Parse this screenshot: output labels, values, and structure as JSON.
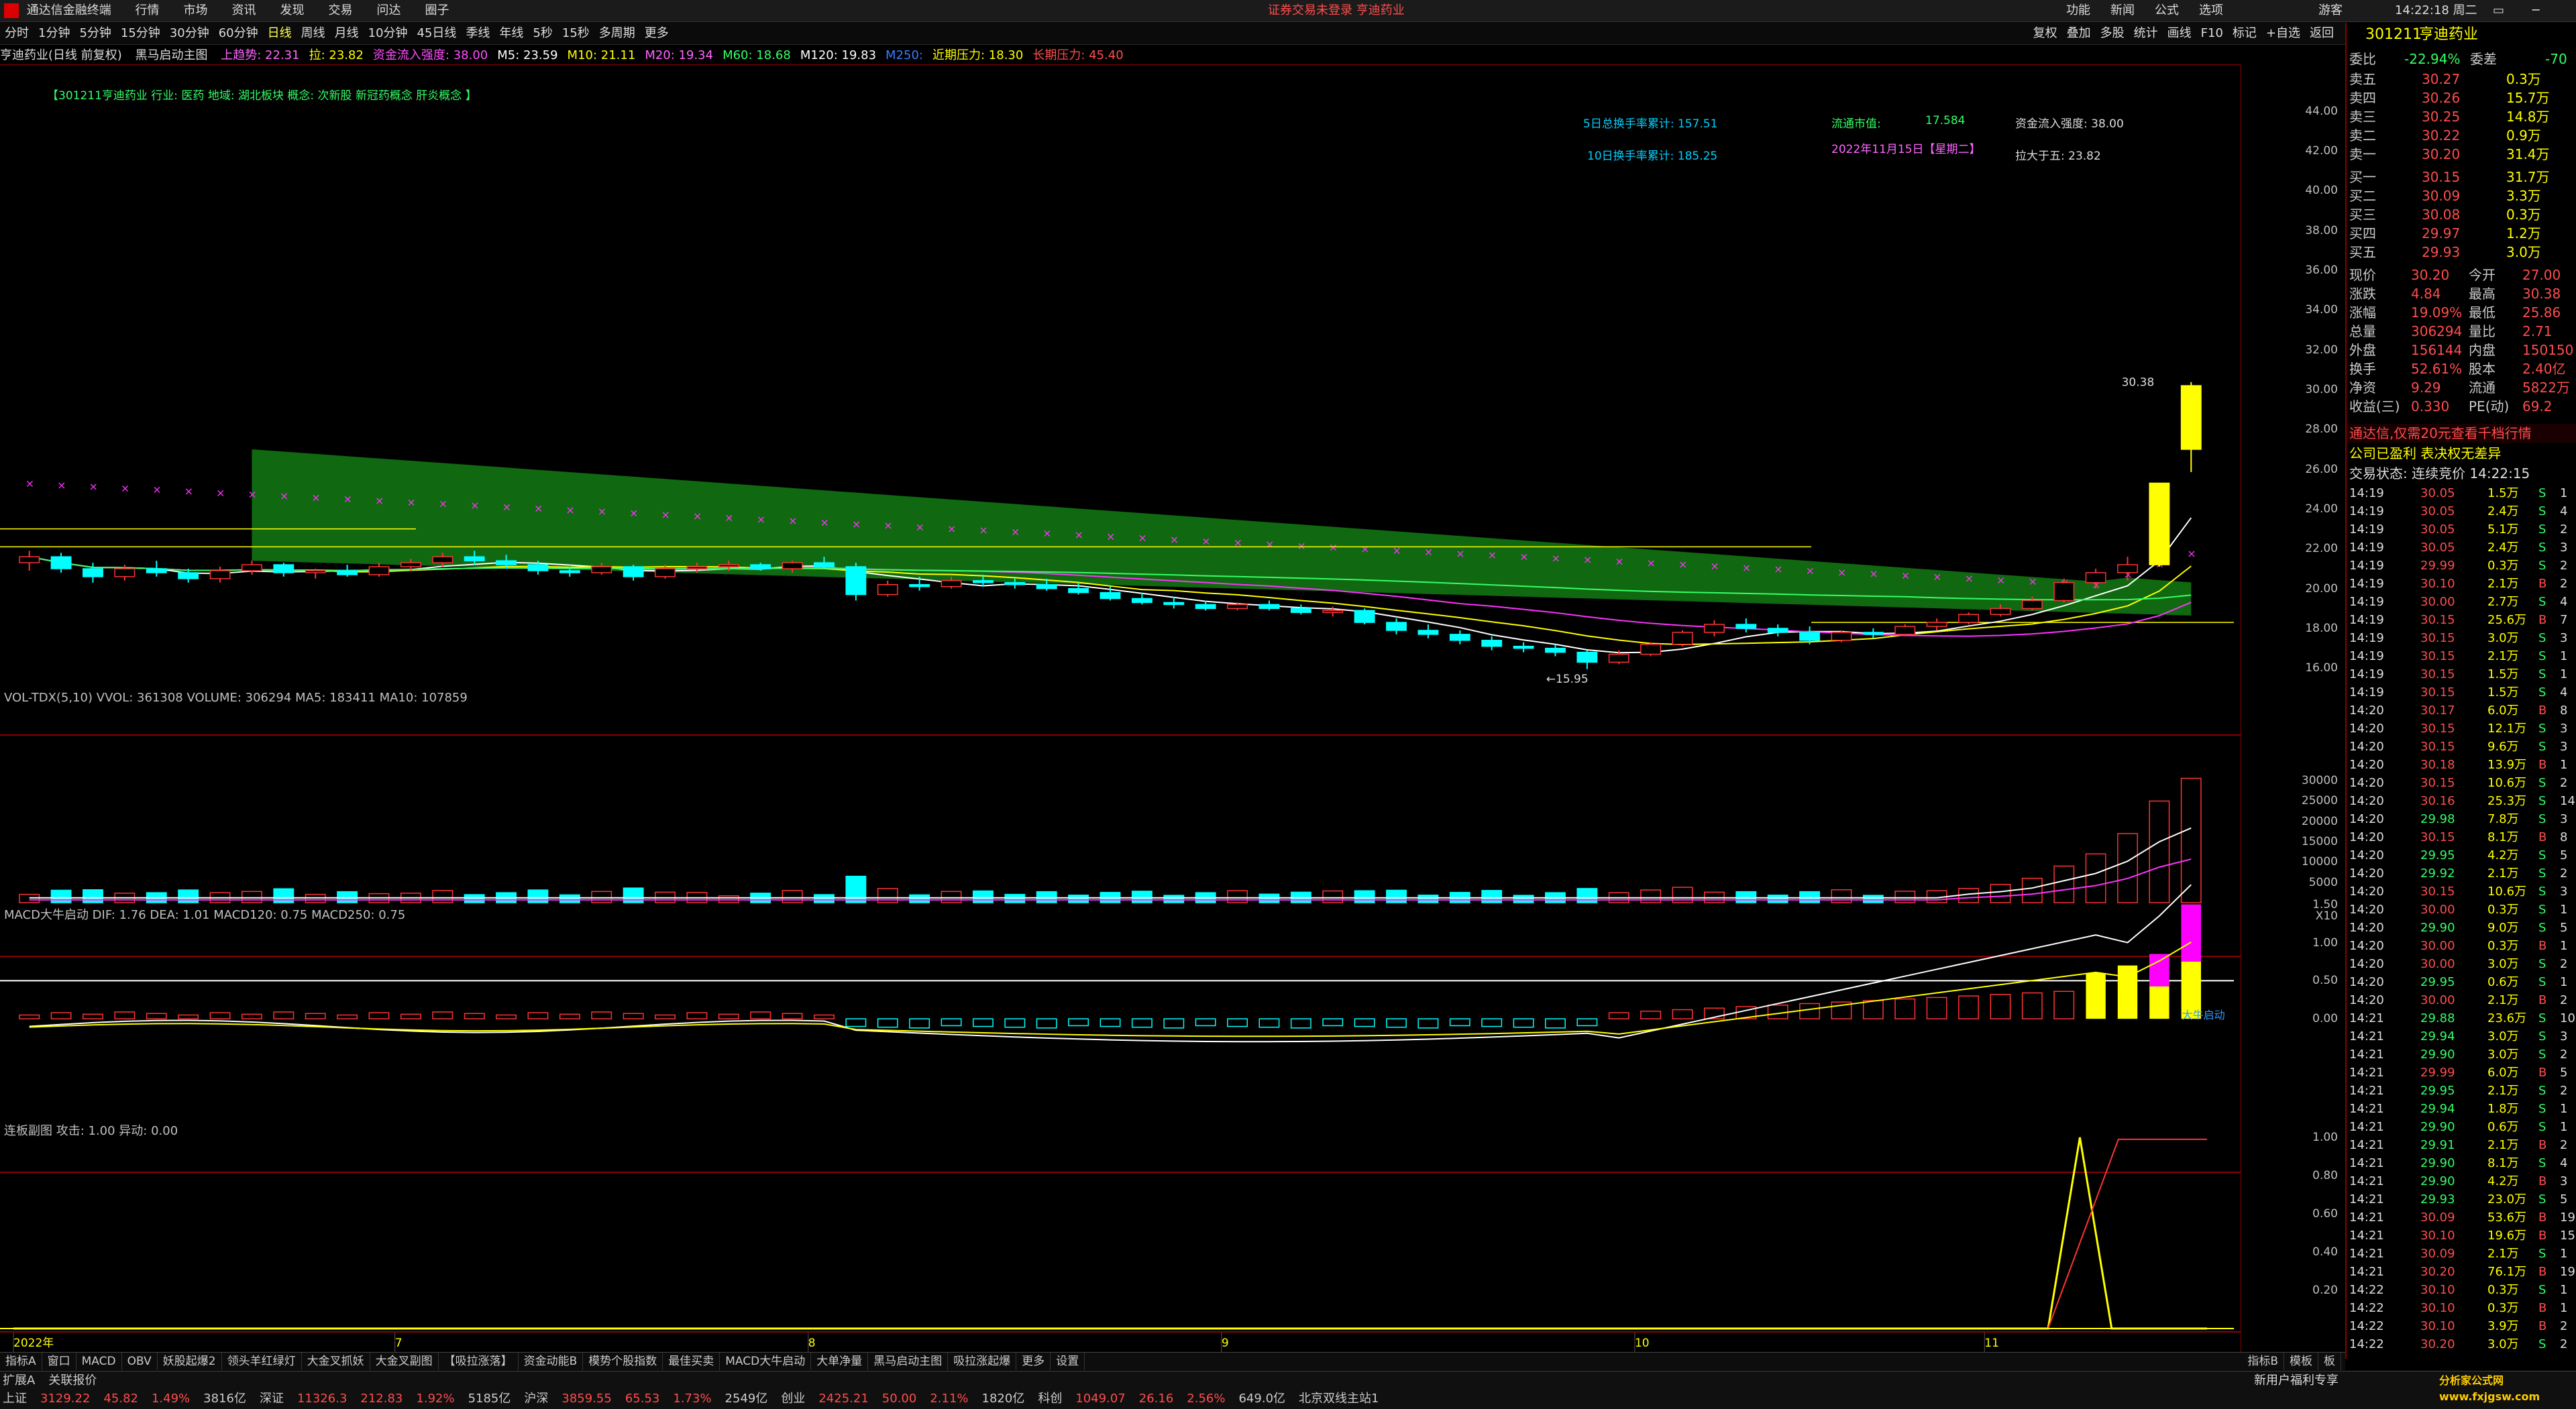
{
  "app": {
    "title": "通达信金融终端",
    "menus": [
      "行情",
      "市场",
      "资讯",
      "发现",
      "交易",
      "问达",
      "圈子"
    ],
    "center_notice": "证券交易未登录 亨迪药业",
    "right_menus": [
      "功能",
      "新闻",
      "公式",
      "选项"
    ],
    "user": "游客",
    "clock": "14:22:18 周二"
  },
  "toolbar": {
    "periods": [
      "分时",
      "1分钟",
      "5分钟",
      "15分钟",
      "30分钟",
      "60分钟",
      "日线",
      "周线",
      "月线",
      "10分钟",
      "45日线",
      "季线",
      "年线",
      "5秒",
      "15秒",
      "多周期",
      "更多"
    ],
    "active_period": "日线",
    "tools": [
      "复权",
      "叠加",
      "多股",
      "统计",
      "画线",
      "F10",
      "标记",
      "+自选",
      "返回"
    ]
  },
  "quote_header": {
    "stock_label": "亨迪药业(日线 前复权)",
    "indicator": "黑马启动主图",
    "items": [
      {
        "text": "上趋势: 22.31",
        "color": "#ff66ff"
      },
      {
        "text": "拉: 23.82",
        "color": "#ffff00"
      },
      {
        "text": "资金流入强度: 38.00",
        "color": "#ff4dff"
      },
      {
        "text": "M5: 23.59",
        "color": "#ffffff"
      },
      {
        "text": "M10: 21.11",
        "color": "#ffff00"
      },
      {
        "text": "M20: 19.34",
        "color": "#ff66ff"
      },
      {
        "text": "M60: 18.68",
        "color": "#33ff66"
      },
      {
        "text": "M120: 19.83",
        "color": "#ffffff"
      },
      {
        "text": "M250:",
        "color": "#3a7bff"
      },
      {
        "text": "近期压力: 18.30",
        "color": "#ffff00"
      },
      {
        "text": "长期压力: 45.40",
        "color": "#ff4d4d"
      }
    ]
  },
  "info_line": "【301211亨迪药业  行业: 医药  地域: 湖北板块  概念: 次新股 新冠药概念 肝炎概念 】",
  "overlay_stats": {
    "turnover5": "5日总换手率累计: 157.51",
    "turnover10": "10日换手率累计: 185.25",
    "float_mv_label": "流通市值:",
    "float_mv_value": "17.584",
    "date": "2022年11月15日【星期二】",
    "fund_strength": "资金流入强度: 38.00",
    "pull_5": "拉大于五: 23.82"
  },
  "main_axis": {
    "ticks": [
      "44.00",
      "42.00",
      "40.00",
      "38.00",
      "36.00",
      "34.00",
      "32.00",
      "30.00",
      "28.00",
      "26.00",
      "24.00",
      "22.00",
      "20.00",
      "18.00",
      "16.00"
    ],
    "high_label": "30.38",
    "low_label": "15.95"
  },
  "chart_data": {
    "type": "candlestick",
    "title": "亨迪药业(日线 前复权)",
    "x_labels": [
      "2022年",
      "7",
      "8",
      "9",
      "10",
      "11"
    ],
    "ylim": [
      15,
      45
    ],
    "candles": [
      {
        "o": 21.3,
        "h": 21.9,
        "l": 20.9,
        "c": 21.6
      },
      {
        "o": 21.6,
        "h": 21.8,
        "l": 20.8,
        "c": 21.0
      },
      {
        "o": 21.0,
        "h": 21.3,
        "l": 20.3,
        "c": 20.6
      },
      {
        "o": 20.6,
        "h": 21.2,
        "l": 20.4,
        "c": 21.0
      },
      {
        "o": 21.0,
        "h": 21.4,
        "l": 20.6,
        "c": 20.8
      },
      {
        "o": 20.8,
        "h": 21.0,
        "l": 20.3,
        "c": 20.5
      },
      {
        "o": 20.5,
        "h": 21.1,
        "l": 20.3,
        "c": 20.9
      },
      {
        "o": 20.9,
        "h": 21.4,
        "l": 20.7,
        "c": 21.2
      },
      {
        "o": 21.2,
        "h": 21.3,
        "l": 20.6,
        "c": 20.8
      },
      {
        "o": 20.8,
        "h": 21.0,
        "l": 20.5,
        "c": 20.9
      },
      {
        "o": 20.9,
        "h": 21.2,
        "l": 20.6,
        "c": 20.7
      },
      {
        "o": 20.7,
        "h": 21.3,
        "l": 20.6,
        "c": 21.1
      },
      {
        "o": 21.1,
        "h": 21.5,
        "l": 20.9,
        "c": 21.3
      },
      {
        "o": 21.3,
        "h": 21.8,
        "l": 21.1,
        "c": 21.6
      },
      {
        "o": 21.6,
        "h": 21.9,
        "l": 21.2,
        "c": 21.4
      },
      {
        "o": 21.4,
        "h": 21.7,
        "l": 21.0,
        "c": 21.2
      },
      {
        "o": 21.2,
        "h": 21.4,
        "l": 20.7,
        "c": 20.9
      },
      {
        "o": 20.9,
        "h": 21.1,
        "l": 20.6,
        "c": 20.8
      },
      {
        "o": 20.8,
        "h": 21.3,
        "l": 20.7,
        "c": 21.1
      },
      {
        "o": 21.1,
        "h": 21.2,
        "l": 20.4,
        "c": 20.6
      },
      {
        "o": 20.6,
        "h": 21.2,
        "l": 20.5,
        "c": 21.0
      },
      {
        "o": 21.0,
        "h": 21.3,
        "l": 20.8,
        "c": 21.1
      },
      {
        "o": 21.1,
        "h": 21.4,
        "l": 20.9,
        "c": 21.2
      },
      {
        "o": 21.2,
        "h": 21.3,
        "l": 20.9,
        "c": 21.0
      },
      {
        "o": 21.0,
        "h": 21.4,
        "l": 20.8,
        "c": 21.3
      },
      {
        "o": 21.3,
        "h": 21.6,
        "l": 21.0,
        "c": 21.1
      },
      {
        "o": 21.1,
        "h": 21.3,
        "l": 19.4,
        "c": 19.7
      },
      {
        "o": 19.7,
        "h": 20.4,
        "l": 19.6,
        "c": 20.2
      },
      {
        "o": 20.2,
        "h": 20.6,
        "l": 19.9,
        "c": 20.1
      },
      {
        "o": 20.1,
        "h": 20.6,
        "l": 20.0,
        "c": 20.4
      },
      {
        "o": 20.4,
        "h": 20.7,
        "l": 20.1,
        "c": 20.3
      },
      {
        "o": 20.3,
        "h": 20.5,
        "l": 20.0,
        "c": 20.2
      },
      {
        "o": 20.2,
        "h": 20.5,
        "l": 19.9,
        "c": 20.0
      },
      {
        "o": 20.0,
        "h": 20.3,
        "l": 19.7,
        "c": 19.8
      },
      {
        "o": 19.8,
        "h": 20.1,
        "l": 19.4,
        "c": 19.5
      },
      {
        "o": 19.5,
        "h": 19.8,
        "l": 19.2,
        "c": 19.3
      },
      {
        "o": 19.3,
        "h": 19.6,
        "l": 19.0,
        "c": 19.2
      },
      {
        "o": 19.2,
        "h": 19.4,
        "l": 18.9,
        "c": 19.0
      },
      {
        "o": 19.0,
        "h": 19.3,
        "l": 18.9,
        "c": 19.2
      },
      {
        "o": 19.2,
        "h": 19.4,
        "l": 18.9,
        "c": 19.0
      },
      {
        "o": 19.0,
        "h": 19.2,
        "l": 18.7,
        "c": 18.8
      },
      {
        "o": 18.8,
        "h": 19.1,
        "l": 18.6,
        "c": 18.9
      },
      {
        "o": 18.9,
        "h": 19.0,
        "l": 18.2,
        "c": 18.3
      },
      {
        "o": 18.3,
        "h": 18.5,
        "l": 17.7,
        "c": 17.9
      },
      {
        "o": 17.9,
        "h": 18.2,
        "l": 17.5,
        "c": 17.7
      },
      {
        "o": 17.7,
        "h": 17.9,
        "l": 17.2,
        "c": 17.4
      },
      {
        "o": 17.4,
        "h": 17.6,
        "l": 16.9,
        "c": 17.1
      },
      {
        "o": 17.1,
        "h": 17.3,
        "l": 16.8,
        "c": 17.0
      },
      {
        "o": 17.0,
        "h": 17.2,
        "l": 16.6,
        "c": 16.8
      },
      {
        "o": 16.8,
        "h": 16.9,
        "l": 15.95,
        "c": 16.3
      },
      {
        "o": 16.3,
        "h": 16.9,
        "l": 16.2,
        "c": 16.7
      },
      {
        "o": 16.7,
        "h": 17.3,
        "l": 16.6,
        "c": 17.2
      },
      {
        "o": 17.2,
        "h": 17.9,
        "l": 17.1,
        "c": 17.8
      },
      {
        "o": 17.8,
        "h": 18.4,
        "l": 17.6,
        "c": 18.2
      },
      {
        "o": 18.2,
        "h": 18.5,
        "l": 17.8,
        "c": 18.0
      },
      {
        "o": 18.0,
        "h": 18.2,
        "l": 17.6,
        "c": 17.8
      },
      {
        "o": 17.8,
        "h": 18.1,
        "l": 17.2,
        "c": 17.4
      },
      {
        "o": 17.4,
        "h": 17.9,
        "l": 17.3,
        "c": 17.8
      },
      {
        "o": 17.8,
        "h": 18.0,
        "l": 17.5,
        "c": 17.7
      },
      {
        "o": 17.7,
        "h": 18.2,
        "l": 17.6,
        "c": 18.1
      },
      {
        "o": 18.1,
        "h": 18.5,
        "l": 17.9,
        "c": 18.3
      },
      {
        "o": 18.3,
        "h": 18.8,
        "l": 18.2,
        "c": 18.7
      },
      {
        "o": 18.7,
        "h": 19.2,
        "l": 18.6,
        "c": 19.0
      },
      {
        "o": 19.0,
        "h": 19.6,
        "l": 18.9,
        "c": 19.4
      },
      {
        "o": 19.4,
        "h": 20.5,
        "l": 19.3,
        "c": 20.3
      },
      {
        "o": 20.3,
        "h": 21.0,
        "l": 20.0,
        "c": 20.8
      },
      {
        "o": 20.8,
        "h": 21.6,
        "l": 20.4,
        "c": 21.2
      },
      {
        "o": 21.2,
        "h": 25.3,
        "l": 21.1,
        "c": 25.3
      },
      {
        "o": 27.0,
        "h": 30.38,
        "l": 25.86,
        "c": 30.2
      }
    ],
    "volume": {
      "header": "VOL-TDX(5,10)  VVOL: 361308  VOLUME: 306294  MA5: 183411  MA10: 107859",
      "ticks": [
        "30000",
        "25000",
        "20000",
        "15000",
        "10000",
        "5000",
        "X10"
      ]
    },
    "macd": {
      "header": "MACD大牛启动  DIF: 1.76  DEA: 1.01  MACD120: 0.75  MACD250: 0.75",
      "ticks": [
        "1.50",
        "1.00",
        "0.50",
        "0.00"
      ],
      "label": "大牛启动"
    },
    "signal": {
      "header": "连板副图  攻击: 1.00  异动: 0.00",
      "ticks": [
        "1.00",
        "0.80",
        "0.60",
        "0.40",
        "0.20"
      ]
    }
  },
  "right_panel": {
    "code": "301211",
    "name": "亨迪药业",
    "weibi_label": "委比",
    "weibi": "-22.94%",
    "weicha_label": "委差",
    "weicha": "-70",
    "asks": [
      {
        "label": "卖五",
        "price": "30.27",
        "vol": "0.3万"
      },
      {
        "label": "卖四",
        "price": "30.26",
        "vol": "15.7万"
      },
      {
        "label": "卖三",
        "price": "30.25",
        "vol": "14.8万"
      },
      {
        "label": "卖二",
        "price": "30.22",
        "vol": "0.9万"
      },
      {
        "label": "卖一",
        "price": "30.20",
        "vol": "31.4万"
      }
    ],
    "bids": [
      {
        "label": "买一",
        "price": "30.15",
        "vol": "31.7万"
      },
      {
        "label": "买二",
        "price": "30.09",
        "vol": "3.3万"
      },
      {
        "label": "买三",
        "price": "30.08",
        "vol": "0.3万"
      },
      {
        "label": "买四",
        "price": "29.97",
        "vol": "1.2万"
      },
      {
        "label": "买五",
        "price": "29.93",
        "vol": "3.0万"
      }
    ],
    "stats": [
      {
        "l1": "现价",
        "v1": "30.20",
        "l2": "今开",
        "v2": "27.00"
      },
      {
        "l1": "涨跌",
        "v1": "4.84",
        "l2": "最高",
        "v2": "30.38"
      },
      {
        "l1": "涨幅",
        "v1": "19.09%",
        "l2": "最低",
        "v2": "25.86"
      },
      {
        "l1": "总量",
        "v1": "306294",
        "l2": "量比",
        "v2": "2.71"
      },
      {
        "l1": "外盘",
        "v1": "156144",
        "l2": "内盘",
        "v2": "150150"
      },
      {
        "l1": "换手",
        "v1": "52.61%",
        "l2": "股本",
        "v2": "2.40亿"
      },
      {
        "l1": "净资",
        "v1": "9.29",
        "l2": "流通",
        "v2": "5822万"
      },
      {
        "l1": "收益(三)",
        "v1": "0.330",
        "l2": "PE(动)",
        "v2": "69.2"
      }
    ],
    "promo1": "通达信,仅需20元查看千档行情",
    "promo2": "公司已盈利 表决权无差异",
    "trade_state": "交易状态: 连续竞价 14:22:15",
    "ticks": [
      [
        "14:19",
        "30.05",
        "1.5万",
        "S",
        "1"
      ],
      [
        "14:19",
        "30.05",
        "2.4万",
        "S",
        "4"
      ],
      [
        "14:19",
        "30.05",
        "5.1万",
        "S",
        "2"
      ],
      [
        "14:19",
        "30.05",
        "2.4万",
        "S",
        "3"
      ],
      [
        "14:19",
        "29.99",
        "0.3万",
        "S",
        "2"
      ],
      [
        "14:19",
        "30.10",
        "2.1万",
        "B",
        "2"
      ],
      [
        "14:19",
        "30.00",
        "2.7万",
        "S",
        "4"
      ],
      [
        "14:19",
        "30.15",
        "25.6万",
        "B",
        "7"
      ],
      [
        "14:19",
        "30.15",
        "3.0万",
        "S",
        "3"
      ],
      [
        "14:19",
        "30.15",
        "2.1万",
        "S",
        "1"
      ],
      [
        "14:19",
        "30.15",
        "1.5万",
        "S",
        "1"
      ],
      [
        "14:19",
        "30.15",
        "1.5万",
        "S",
        "4"
      ],
      [
        "14:20",
        "30.17",
        "6.0万",
        "B",
        "8"
      ],
      [
        "14:20",
        "30.15",
        "12.1万",
        "S",
        "3"
      ],
      [
        "14:20",
        "30.15",
        "9.6万",
        "S",
        "3"
      ],
      [
        "14:20",
        "30.18",
        "13.9万",
        "B",
        "1"
      ],
      [
        "14:20",
        "30.15",
        "10.6万",
        "S",
        "2"
      ],
      [
        "14:20",
        "30.16",
        "25.3万",
        "S",
        "14"
      ],
      [
        "14:20",
        "29.98",
        "7.8万",
        "S",
        "3"
      ],
      [
        "14:20",
        "30.15",
        "8.1万",
        "B",
        "8"
      ],
      [
        "14:20",
        "29.95",
        "4.2万",
        "S",
        "5"
      ],
      [
        "14:20",
        "29.92",
        "2.1万",
        "S",
        "2"
      ],
      [
        "14:20",
        "30.15",
        "10.6万",
        "S",
        "3"
      ],
      [
        "14:20",
        "30.00",
        "0.3万",
        "S",
        "1"
      ],
      [
        "14:20",
        "29.90",
        "9.0万",
        "S",
        "5"
      ],
      [
        "14:20",
        "30.00",
        "0.3万",
        "B",
        "1"
      ],
      [
        "14:20",
        "30.00",
        "3.0万",
        "S",
        "2"
      ],
      [
        "14:20",
        "29.95",
        "0.6万",
        "S",
        "1"
      ],
      [
        "14:20",
        "30.00",
        "2.1万",
        "B",
        "2"
      ],
      [
        "14:21",
        "29.88",
        "23.6万",
        "S",
        "10"
      ],
      [
        "14:21",
        "29.94",
        "3.0万",
        "S",
        "3"
      ],
      [
        "14:21",
        "29.90",
        "3.0万",
        "S",
        "2"
      ],
      [
        "14:21",
        "29.99",
        "6.0万",
        "B",
        "5"
      ],
      [
        "14:21",
        "29.95",
        "2.1万",
        "S",
        "2"
      ],
      [
        "14:21",
        "29.94",
        "1.8万",
        "S",
        "1"
      ],
      [
        "14:21",
        "29.90",
        "0.6万",
        "S",
        "1"
      ],
      [
        "14:21",
        "29.91",
        "2.1万",
        "B",
        "2"
      ],
      [
        "14:21",
        "29.90",
        "8.1万",
        "S",
        "4"
      ],
      [
        "14:21",
        "29.90",
        "4.2万",
        "B",
        "3"
      ],
      [
        "14:21",
        "29.93",
        "23.0万",
        "S",
        "5"
      ],
      [
        "14:21",
        "30.09",
        "53.6万",
        "B",
        "19"
      ],
      [
        "14:21",
        "30.10",
        "19.6万",
        "B",
        "15"
      ],
      [
        "14:21",
        "30.09",
        "2.1万",
        "S",
        "1"
      ],
      [
        "14:21",
        "30.20",
        "76.1万",
        "B",
        "19"
      ],
      [
        "14:22",
        "30.10",
        "0.3万",
        "S",
        "1"
      ],
      [
        "14:22",
        "30.10",
        "0.3万",
        "B",
        "1"
      ],
      [
        "14:22",
        "30.10",
        "3.9万",
        "B",
        "2"
      ],
      [
        "14:22",
        "30.20",
        "3.0万",
        "S",
        "2"
      ]
    ]
  },
  "bottom_tabs": [
    "指标A",
    "窗口",
    "MACD",
    "OBV",
    "妖股起爆2",
    "领头羊红绿灯",
    "大金叉抓妖",
    "大金叉副图",
    "【吸拉涨落】",
    "资金动能B",
    "模势个股指数",
    "最佳买卖",
    "MACD大牛启动",
    "大单净量",
    "黑马启动主图",
    "吸拉涨起爆",
    "更多",
    "设置"
  ],
  "bottom_right_tabs": [
    "指标B",
    "模板",
    "板"
  ],
  "status": {
    "line1": [
      {
        "text": "扩展A",
        "color": "#ccc"
      },
      {
        "text": "关联报价",
        "color": "#ccc"
      }
    ],
    "line2": [
      {
        "text": "上证",
        "color": "#ccc"
      },
      {
        "text": "3129.22",
        "color": "#ff4d4d"
      },
      {
        "text": "45.82",
        "color": "#ff4d4d"
      },
      {
        "text": "1.49%",
        "color": "#ff4d4d"
      },
      {
        "text": "3816亿",
        "color": "#ccc"
      },
      {
        "text": "深证",
        "color": "#ccc"
      },
      {
        "text": "11326.3",
        "color": "#ff4d4d"
      },
      {
        "text": "212.83",
        "color": "#ff4d4d"
      },
      {
        "text": "1.92%",
        "color": "#ff4d4d"
      },
      {
        "text": "5185亿",
        "color": "#ccc"
      },
      {
        "text": "沪深",
        "color": "#ccc"
      },
      {
        "text": "3859.55",
        "color": "#ff4d4d"
      },
      {
        "text": "65.53",
        "color": "#ff4d4d"
      },
      {
        "text": "1.73%",
        "color": "#ff4d4d"
      },
      {
        "text": "2549亿",
        "color": "#ccc"
      },
      {
        "text": "创业",
        "color": "#ccc"
      },
      {
        "text": "2425.21",
        "color": "#ff4d4d"
      },
      {
        "text": "50.00",
        "color": "#ff4d4d"
      },
      {
        "text": "2.11%",
        "color": "#ff4d4d"
      },
      {
        "text": "1820亿",
        "color": "#ccc"
      },
      {
        "text": "科创",
        "color": "#ccc"
      },
      {
        "text": "1049.07",
        "color": "#ff4d4d"
      },
      {
        "text": "26.16",
        "color": "#ff4d4d"
      },
      {
        "text": "2.56%",
        "color": "#ff4d4d"
      },
      {
        "text": "649.0亿",
        "color": "#ccc"
      },
      {
        "text": "北京双线主站1",
        "color": "#ccc"
      }
    ],
    "right_text": "新用户福利专享",
    "watermark": "分析家公式网 www.fxjgsw.com"
  }
}
